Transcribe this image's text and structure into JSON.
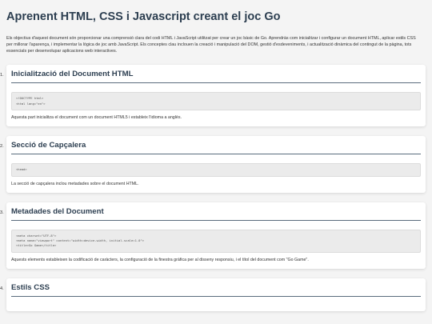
{
  "title": "Aprenent HTML, CSS i Javascript creant el joc Go",
  "intro": "Els objectius d'aquest document són proporcionar una comprensió clara del codi HTML i JavaScript utilitzat per crear un joc bàsic de Go. Aprendràs com inicialitzar i configurar un document HTML, aplicar estils CSS per millorar l'aparença, i implementar la lògica de joc amb JavaScript. Els conceptes clau inclouen la creació i manipulació del DOM, gestió d'esdeveniments, i actualització dinàmica del contingut de la pàgina, tots essencials per desenvolupar aplicacions web interactives.",
  "sections": [
    {
      "number": "1.",
      "heading": "Inicialització del Document HTML",
      "code": "<!DOCTYPE html>\n<html lang=\"en\">",
      "description": "Aquesta part inicialitza el document com un document HTML5 i estableix l'idioma a anglès."
    },
    {
      "number": "2.",
      "heading": "Secció de Capçalera",
      "code": "<head>",
      "description": "La secció de capçalera inclou metadades sobre el document HTML."
    },
    {
      "number": "3.",
      "heading": "Metadades del Document",
      "code": "<meta charset=\"UTF-8\">\n<meta name=\"viewport\" content=\"width=device-width, initial-scale=1.0\">\n<title>Go Game</title>",
      "description": "Aquests elements estableixen la codificació de caràcters, la configuració de la finestra gràfica per al disseny responsiu, i el títol del document com \"Go Game\"."
    },
    {
      "number": "4.",
      "heading": "Estils CSS"
    }
  ]
}
